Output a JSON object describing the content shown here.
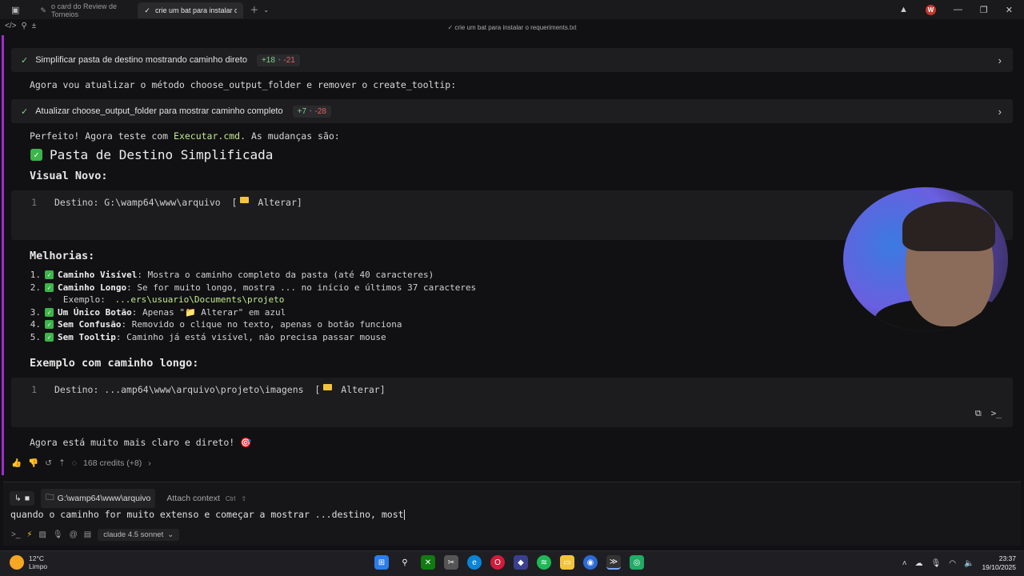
{
  "tabs": [
    {
      "label": "o card do Review de Torneios",
      "active": false
    },
    {
      "label": "crie um bat para instalar o req",
      "active": true
    }
  ],
  "window_title": "crie um bat para instalar o requeriments.txt",
  "steps": {
    "step1": {
      "label": "Simplificar pasta de destino mostrando caminho direto",
      "plus": "+18",
      "minus": "-21"
    },
    "step2": {
      "label": "Atualizar choose_output_folder para mostrar caminho completo",
      "plus": "+7",
      "minus": "-28"
    }
  },
  "messages": {
    "m1": "Agora vou atualizar o método choose_output_folder e remover o create_tooltip:",
    "m2_pre": "Perfeito! Agora teste com ",
    "m2_code": "Executar.cmd",
    "m2_post": ". As mudanças são:",
    "final": "Agora está muito mais claro e direto! 🎯"
  },
  "heading": "Pasta de Destino Simplificada",
  "visual_heading": "Visual Novo:",
  "code1": {
    "num": "1",
    "pre": "Destino: G:\\wamp64\\www\\arquivo  [",
    "post": " Alterar]"
  },
  "improvements_heading": "Melhorias:",
  "improvements": [
    {
      "num": "1.",
      "title": "Caminho Visível",
      "text": ": Mostra o caminho completo da pasta (até 40 caracteres)"
    },
    {
      "num": "2.",
      "title": "Caminho Longo",
      "text": ": Se for muito longo, mostra ... no início e últimos 37 caracteres"
    },
    {
      "num": "3.",
      "title": "Um Único Botão",
      "text": ": Apenas \"📁 Alterar\" em azul"
    },
    {
      "num": "4.",
      "title": "Sem Confusão",
      "text": ": Removido o clique no texto, apenas o botão funciona"
    },
    {
      "num": "5.",
      "title": "Sem Tooltip",
      "text": ": Caminho já está visível, não precisa passar mouse"
    }
  ],
  "example_item": {
    "prefix": "◦  Exemplo: ",
    "path": "...ers\\usuario\\Documents\\projeto"
  },
  "example_heading": "Exemplo com caminho longo:",
  "code2": {
    "num": "1",
    "pre": "Destino: ...amp64\\www\\arquivo\\projeto\\imagens  [",
    "post": " Alterar]"
  },
  "credits": "168 credits (+8)",
  "context_path": "G:\\wamp64\\www\\arquivo",
  "attach_label": "Attach context",
  "attach_kbd": "Ctrl",
  "attach_kbd2": "⇧",
  "prompt_text": "quando o caminho for muito extenso e começar a mostrar ...destino, most",
  "model": "claude 4.5 sonnet",
  "weather": {
    "temp": "12°C",
    "cond": "Limpo"
  },
  "clock": {
    "time": "23:37",
    "date": "19/10/2025"
  },
  "colors": {
    "accent": "#a12ccf",
    "plus": "#7fd28a",
    "minus": "#e06363",
    "check": "#3cb54a"
  }
}
